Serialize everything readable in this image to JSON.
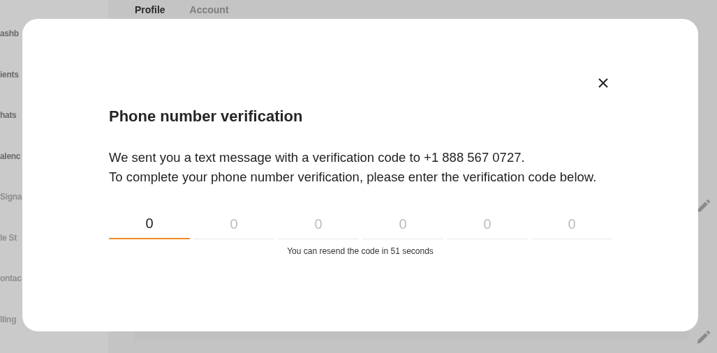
{
  "sidebar": {
    "items": [
      {
        "label": "ashb",
        "disabled": false
      },
      {
        "label": "ients",
        "disabled": false
      },
      {
        "label": "hats",
        "disabled": false
      },
      {
        "label": "alenc",
        "disabled": false
      },
      {
        "label": "Signa",
        "disabled": true
      },
      {
        "label": "le St",
        "disabled": true
      },
      {
        "label": "ontac",
        "disabled": true
      },
      {
        "label": "lling",
        "disabled": true
      }
    ]
  },
  "tabs": [
    {
      "label": "Profile",
      "selected": true
    },
    {
      "label": "Account",
      "selected": false
    }
  ],
  "modal": {
    "title": "Phone number verification",
    "message": [
      "We sent you a text message with a verification code to +1 888 567 0727.",
      "To complete your phone number verification, please enter the verification code below."
    ],
    "code_fields": [
      {
        "placeholder": "0",
        "focused": true
      },
      {
        "placeholder": "0",
        "focused": false
      },
      {
        "placeholder": "0",
        "focused": false
      },
      {
        "placeholder": "0",
        "focused": false
      },
      {
        "placeholder": "0",
        "focused": false
      },
      {
        "placeholder": "0",
        "focused": false
      }
    ],
    "resend_note": "You can resend the code in 51 seconds"
  }
}
